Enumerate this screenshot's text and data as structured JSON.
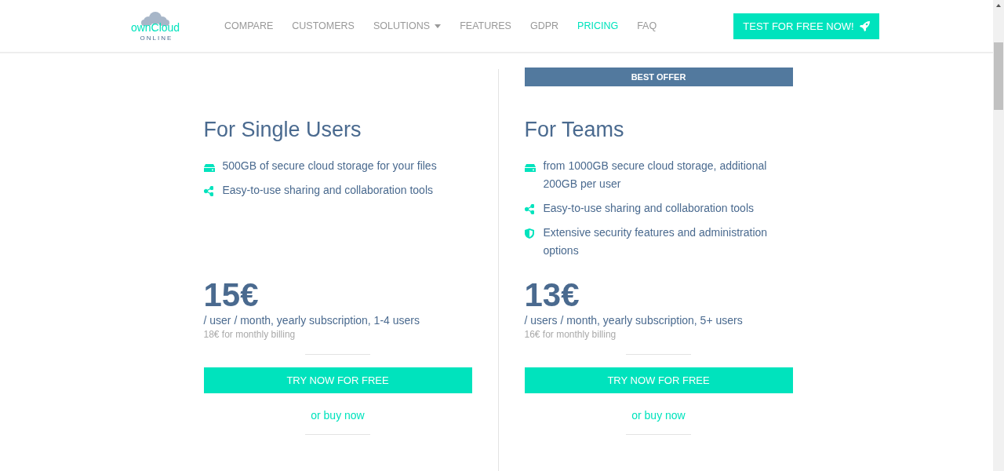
{
  "header": {
    "logo": {
      "name": "ownCloud",
      "subtitle": "ONLINE"
    },
    "nav": [
      {
        "label": "COMPARE",
        "selected": false,
        "dropdown": false
      },
      {
        "label": "CUSTOMERS",
        "selected": false,
        "dropdown": false
      },
      {
        "label": "SOLUTIONS",
        "selected": false,
        "dropdown": true
      },
      {
        "label": "FEATURES",
        "selected": false,
        "dropdown": false
      },
      {
        "label": "GDPR",
        "selected": false,
        "dropdown": false
      },
      {
        "label": "PRICING",
        "selected": true,
        "dropdown": false
      },
      {
        "label": "FAQ",
        "selected": false,
        "dropdown": false
      }
    ],
    "cta": "TEST FOR FREE NOW!"
  },
  "plans": [
    {
      "title": "For Single Users",
      "features": [
        {
          "kind": "storage",
          "text": "500GB of secure cloud storage for your files"
        },
        {
          "kind": "share",
          "text": "Easy-to-use sharing and collaboration tools"
        }
      ],
      "price": "15€",
      "terms": "/ user / month, yearly subscription, 1-4 users",
      "monthly": "18€ for monthly billing",
      "button": "TRY NOW FOR FREE",
      "link": "or buy now"
    },
    {
      "badge": "BEST OFFER",
      "title": "For Teams",
      "features": [
        {
          "kind": "storage",
          "text": "from 1000GB secure cloud storage, additional 200GB per user"
        },
        {
          "kind": "share",
          "text": "Easy-to-use sharing and collaboration tools"
        },
        {
          "kind": "security",
          "text": "Extensive security features and administration options"
        }
      ],
      "price": "13€",
      "terms": "/ users / month, yearly subscription, 5+ users",
      "monthly": "16€ for monthly billing",
      "button": "TRY NOW FOR FREE",
      "link": "or buy now"
    }
  ]
}
